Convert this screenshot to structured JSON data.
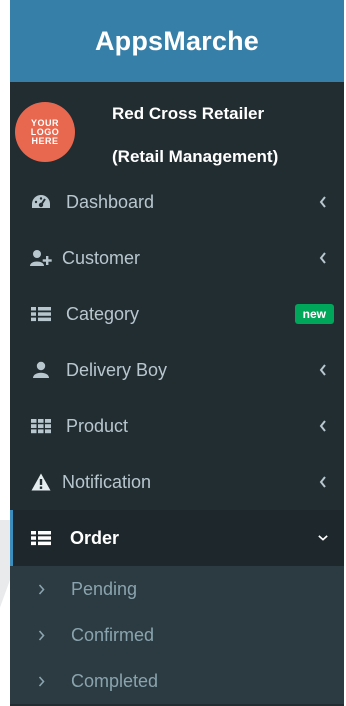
{
  "brand": {
    "title": "AppsMarche"
  },
  "user": {
    "logo_text": [
      "YOUR",
      "LOGO",
      "HERE"
    ],
    "name": "Red Cross Retailer",
    "role": "(Retail Management)"
  },
  "menu": [
    {
      "label": "Dashboard",
      "icon": "dashboard-icon",
      "has_chevron": true
    },
    {
      "label": "Customer",
      "icon": "add-user-icon",
      "has_chevron": true
    },
    {
      "label": "Category",
      "icon": "list-icon",
      "badge": "new"
    },
    {
      "label": "Delivery Boy",
      "icon": "user-icon",
      "has_chevron": true
    },
    {
      "label": "Product",
      "icon": "grid-icon",
      "has_chevron": true
    },
    {
      "label": "Notification",
      "icon": "warning-icon",
      "has_chevron": true
    },
    {
      "label": "Order",
      "icon": "list-icon",
      "expanded": true,
      "children": [
        "Pending",
        "Confirmed",
        "Completed"
      ]
    }
  ],
  "colors": {
    "brand_bar": "#367fa9",
    "sidebar": "#222d32",
    "active": "#1e282c",
    "submenu": "#2c3b41",
    "badge": "#00a65a",
    "logo": "#e8674f"
  }
}
